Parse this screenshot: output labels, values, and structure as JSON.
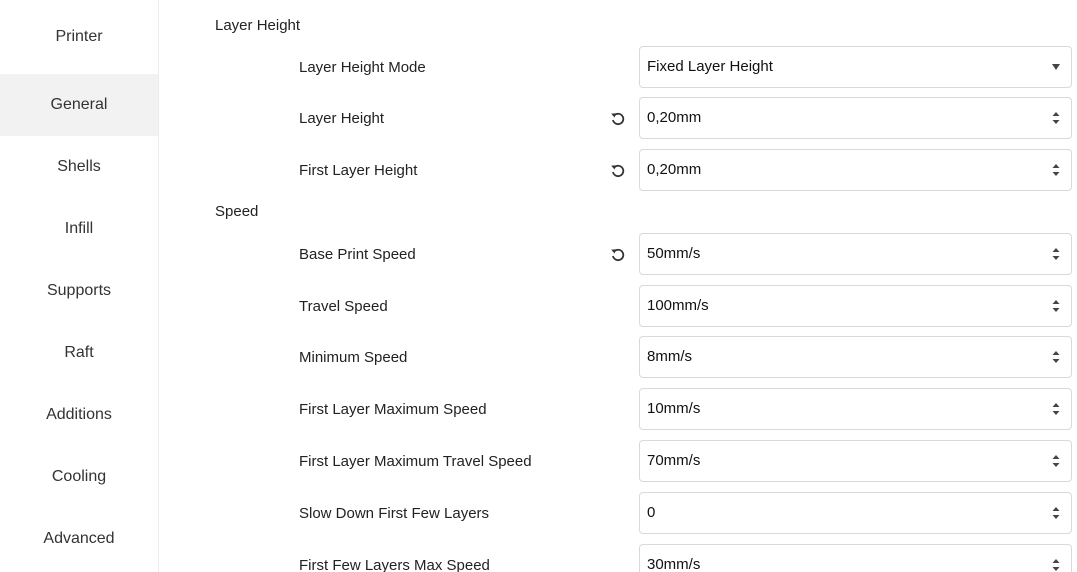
{
  "sidebar": {
    "items": [
      {
        "label": "Printer"
      },
      {
        "label": "General"
      },
      {
        "label": "Shells"
      },
      {
        "label": "Infill"
      },
      {
        "label": "Supports"
      },
      {
        "label": "Raft"
      },
      {
        "label": "Additions"
      },
      {
        "label": "Cooling"
      },
      {
        "label": "Advanced"
      }
    ],
    "active": "General"
  },
  "sections": {
    "layer_height": {
      "title": "Layer Height",
      "mode": {
        "label": "Layer Height Mode",
        "value": "Fixed Layer Height"
      },
      "height": {
        "label": "Layer Height",
        "value": "0,20mm"
      },
      "first_height": {
        "label": "First Layer Height",
        "value": "0,20mm"
      }
    },
    "speed": {
      "title": "Speed",
      "base": {
        "label": "Base Print Speed",
        "value": "50mm/s"
      },
      "travel": {
        "label": "Travel Speed",
        "value": "100mm/s"
      },
      "minimum": {
        "label": "Minimum Speed",
        "value": "8mm/s"
      },
      "first_max": {
        "label": "First Layer Maximum Speed",
        "value": "10mm/s"
      },
      "first_max_travel": {
        "label": "First Layer Maximum Travel Speed",
        "value": "70mm/s"
      },
      "slow_down": {
        "label": "Slow Down First Few Layers",
        "value": "0"
      },
      "few_layers_max": {
        "label": "First Few Layers Max Speed",
        "value": "30mm/s"
      }
    }
  },
  "icons": {
    "reset": "reset-icon",
    "spin": "spinner-arrows-icon",
    "dropdown": "caret-down-icon"
  }
}
